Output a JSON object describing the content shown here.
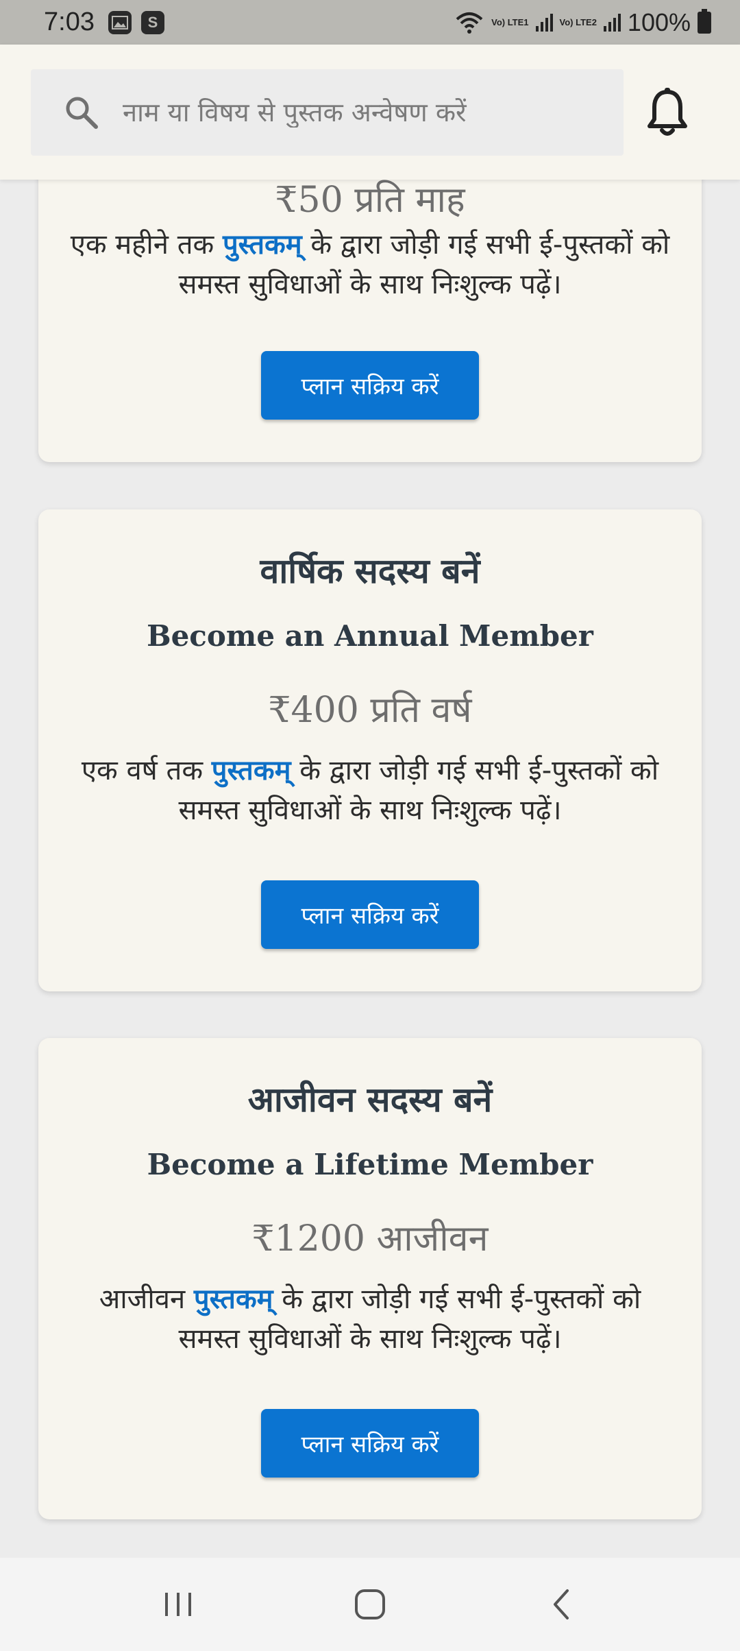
{
  "status_bar": {
    "time": "7:03",
    "app_icon": "S",
    "net1": "Vo) LTE1",
    "net2": "Vo) LTE2",
    "battery": "100%"
  },
  "search": {
    "placeholder": "नाम या विषय से पुस्तक अन्वेषण करें"
  },
  "plans": [
    {
      "price": "₹50 प्रति माह",
      "desc_before": "एक महीने तक ",
      "brand": "पुस्तकम्",
      "desc_after": " के द्वारा जोड़ी गई सभी ई-पुस्तकों को समस्त सुविधाओं के साथ निःशुल्क पढ़ें।",
      "button": "प्लान सक्रिय करें"
    },
    {
      "title": "वार्षिक सदस्य बनें",
      "subtitle": "Become an Annual Member",
      "price": "₹400 प्रति वर्ष",
      "desc_before": "एक वर्ष तक ",
      "brand": "पुस्तकम्",
      "desc_after": " के द्वारा जोड़ी गई सभी ई-पुस्तकों को समस्त सुविधाओं के साथ निःशुल्क पढ़ें।",
      "button": "प्लान सक्रिय करें"
    },
    {
      "title": "आजीवन सदस्य बनें",
      "subtitle": "Become a Lifetime Member",
      "price": "₹1200 आजीवन",
      "desc_before": "आजीवन ",
      "brand": "पुस्तकम्",
      "desc_after": " के द्वारा जोड़ी गई सभी ई-पुस्तकों को समस्त सुविधाओं के साथ निःशुल्क पढ़ें।",
      "button": "प्लान सक्रिय करें"
    }
  ],
  "colors": {
    "accent": "#0b74d1",
    "brand_text": "#0d6fc6",
    "card_bg": "#f7f5ee",
    "page_bg": "#ececec"
  },
  "icons": {
    "search": "search-icon",
    "bell": "bell-icon",
    "recents": "recents-icon",
    "home": "home-icon",
    "back": "back-icon"
  }
}
